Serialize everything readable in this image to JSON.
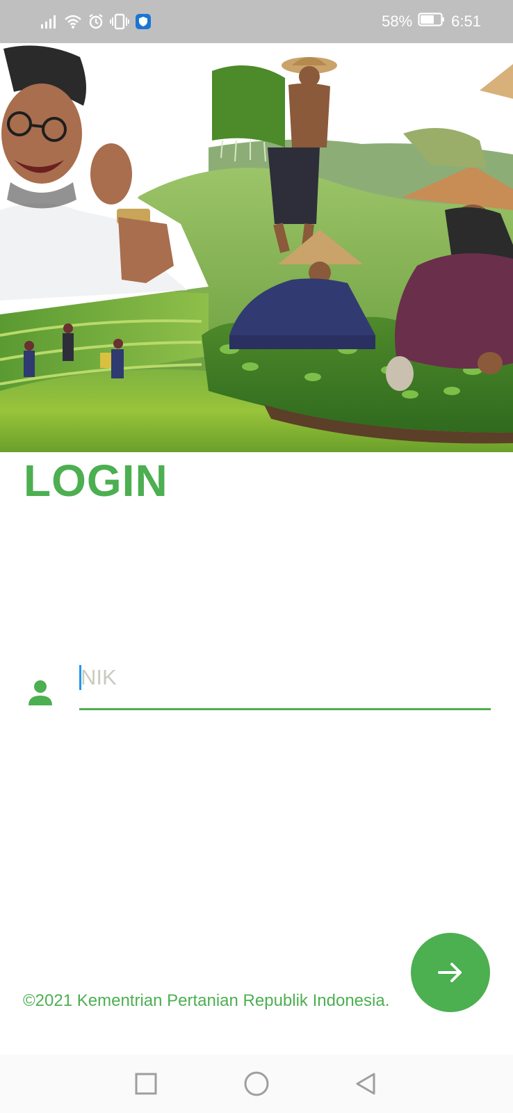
{
  "status_bar": {
    "battery_percent": "58%",
    "time": "6:51",
    "icons": [
      "signal-icon",
      "wifi-icon",
      "alarm-icon",
      "vibrate-icon",
      "shield-app-icon",
      "battery-icon"
    ]
  },
  "login": {
    "title": "LOGIN",
    "nik_placeholder": "NIK",
    "nik_value": ""
  },
  "footer": {
    "copyright": "©2021 Kementrian Pertanian Republik Indonesia."
  },
  "colors": {
    "accent": "#4caf50",
    "status_bar": "#bfbfbf",
    "caret": "#2196f3"
  },
  "nav_bar": {
    "buttons": [
      "recents-icon",
      "home-icon",
      "back-icon"
    ]
  }
}
